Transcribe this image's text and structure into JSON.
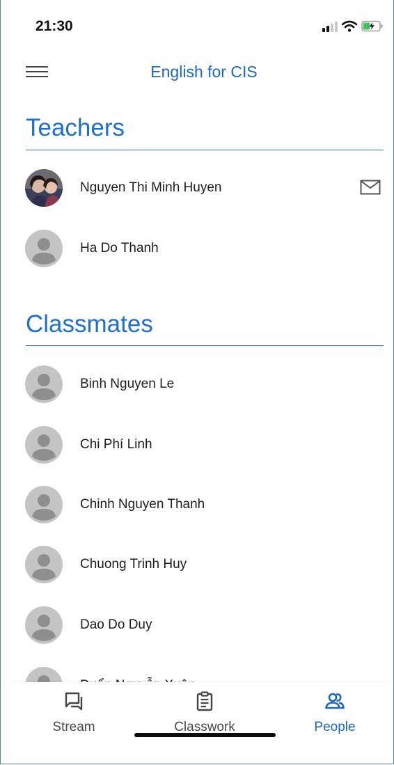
{
  "status": {
    "time": "21:30"
  },
  "app_bar": {
    "title": "English for CIS"
  },
  "teachers": {
    "heading": "Teachers",
    "people": [
      {
        "name": "Nguyen Thi Minh Huyen",
        "has_photo": true,
        "has_email": true
      },
      {
        "name": "Ha Do Thanh",
        "has_photo": false,
        "has_email": false
      }
    ]
  },
  "classmates": {
    "heading": "Classmates",
    "people": [
      {
        "name": "Binh Nguyen Le"
      },
      {
        "name": "Chi Phí Linh"
      },
      {
        "name": "Chinh Nguyen Thanh"
      },
      {
        "name": "Chuong Trinh Huy"
      },
      {
        "name": "Dao Do Duy"
      },
      {
        "name": "Duẩn Nguyễn Xuân"
      }
    ]
  },
  "nav": {
    "items": [
      {
        "label": "Stream",
        "icon": "stream-icon",
        "active": false
      },
      {
        "label": "Classwork",
        "icon": "classwork-icon",
        "active": false
      },
      {
        "label": "People",
        "icon": "people-icon",
        "active": true
      }
    ]
  },
  "colors": {
    "accent": "#1a66c9",
    "avatar_bg": "#c4c4c4",
    "avatar_fg": "#8e8e8e"
  }
}
